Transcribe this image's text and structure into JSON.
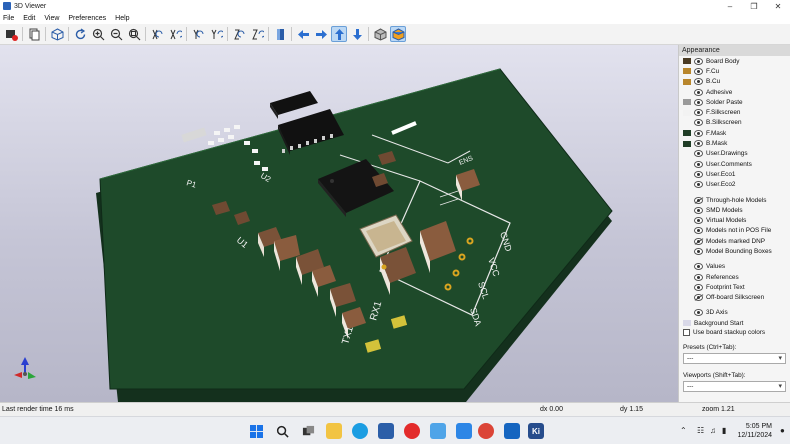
{
  "window": {
    "title": "3D Viewer"
  },
  "menu": [
    "File",
    "Edit",
    "View",
    "Preferences",
    "Help"
  ],
  "toolbar_icons": [
    "render-raytrace-icon",
    "copy-image-icon",
    "board-3d-icon",
    "reload-icon",
    "zoom-in-icon",
    "zoom-out-icon",
    "zoom-fit-icon",
    "rotate-x-cw-icon",
    "rotate-x-ccw-icon",
    "rotate-y-cw-icon",
    "rotate-y-ccw-icon",
    "rotate-z-cw-icon",
    "rotate-z-ccw-icon",
    "flip-board-icon",
    "pan-left-icon",
    "pan-right-icon",
    "pan-up-icon",
    "pan-down-icon",
    "ortho-icon",
    "board-body-view-icon"
  ],
  "board_silkscreen": {
    "p1": "P1",
    "u1": "U1",
    "u2": "U2",
    "u3": "U3",
    "ens": "ENS",
    "gnd": "GND",
    "vcc": "VCC",
    "scl": "SCL",
    "sda": "SDA",
    "tx1": "TX1",
    "rx1": "RX1"
  },
  "appearance": {
    "header": "Appearance",
    "layers": [
      {
        "name": "Board Body",
        "color": "#4a3b24",
        "kind": "swatch"
      },
      {
        "name": "F.Cu",
        "color": "#b8862c",
        "kind": "swatch"
      },
      {
        "name": "B.Cu",
        "color": "#b8862c",
        "kind": "swatch"
      },
      {
        "name": "Adhesive",
        "kind": "eye"
      },
      {
        "name": "Solder Paste",
        "color": "#9a9a9a",
        "kind": "swatch"
      },
      {
        "name": "F.Silkscreen",
        "color": "#f2f2f2",
        "kind": "swatch"
      },
      {
        "name": "B.Silkscreen",
        "kind": "eye"
      },
      {
        "name": "F.Mask",
        "color": "#1f3d26",
        "kind": "swatch"
      },
      {
        "name": "B.Mask",
        "color": "#1f3d26",
        "kind": "swatch"
      },
      {
        "name": "User.Drawings",
        "kind": "eye"
      },
      {
        "name": "User.Comments",
        "kind": "eye"
      },
      {
        "name": "User.Eco1",
        "kind": "eye"
      },
      {
        "name": "User.Eco2",
        "kind": "eye"
      }
    ],
    "models": [
      "Through-hole Models",
      "SMD Models",
      "Virtual Models",
      "Models not in POS File",
      "Models marked DNP",
      "Model Bounding Boxes"
    ],
    "text_items": [
      "Values",
      "References",
      "Footprint Text",
      "Off-board Silkscreen"
    ],
    "misc": [
      {
        "name": "3D Axis",
        "kind": "eye"
      },
      {
        "name": "Background Start",
        "color": "#d8d8e8",
        "kind": "swatch"
      }
    ],
    "stackup_label": "Use board stackup colors",
    "presets_label": "Presets (Ctrl+Tab):",
    "presets_value": "---",
    "viewports_label": "Viewports (Shift+Tab):",
    "viewports_value": "---"
  },
  "status": {
    "render_time": "Last render time 16 ms",
    "dx": "dx 0.00",
    "dy": "dy 1.15",
    "zoom": "zoom 1.21"
  },
  "taskbar": {
    "apps": [
      "windows-start-icon",
      "search-icon",
      "task-view-icon",
      "file-explorer-icon",
      "edge-icon",
      "store-icon",
      "opera-icon",
      "mail-icon",
      "photos-icon",
      "chrome-icon",
      "outlook-icon",
      "kicad-icon"
    ],
    "time": "5:05 PM",
    "date": "12/11/2024"
  }
}
